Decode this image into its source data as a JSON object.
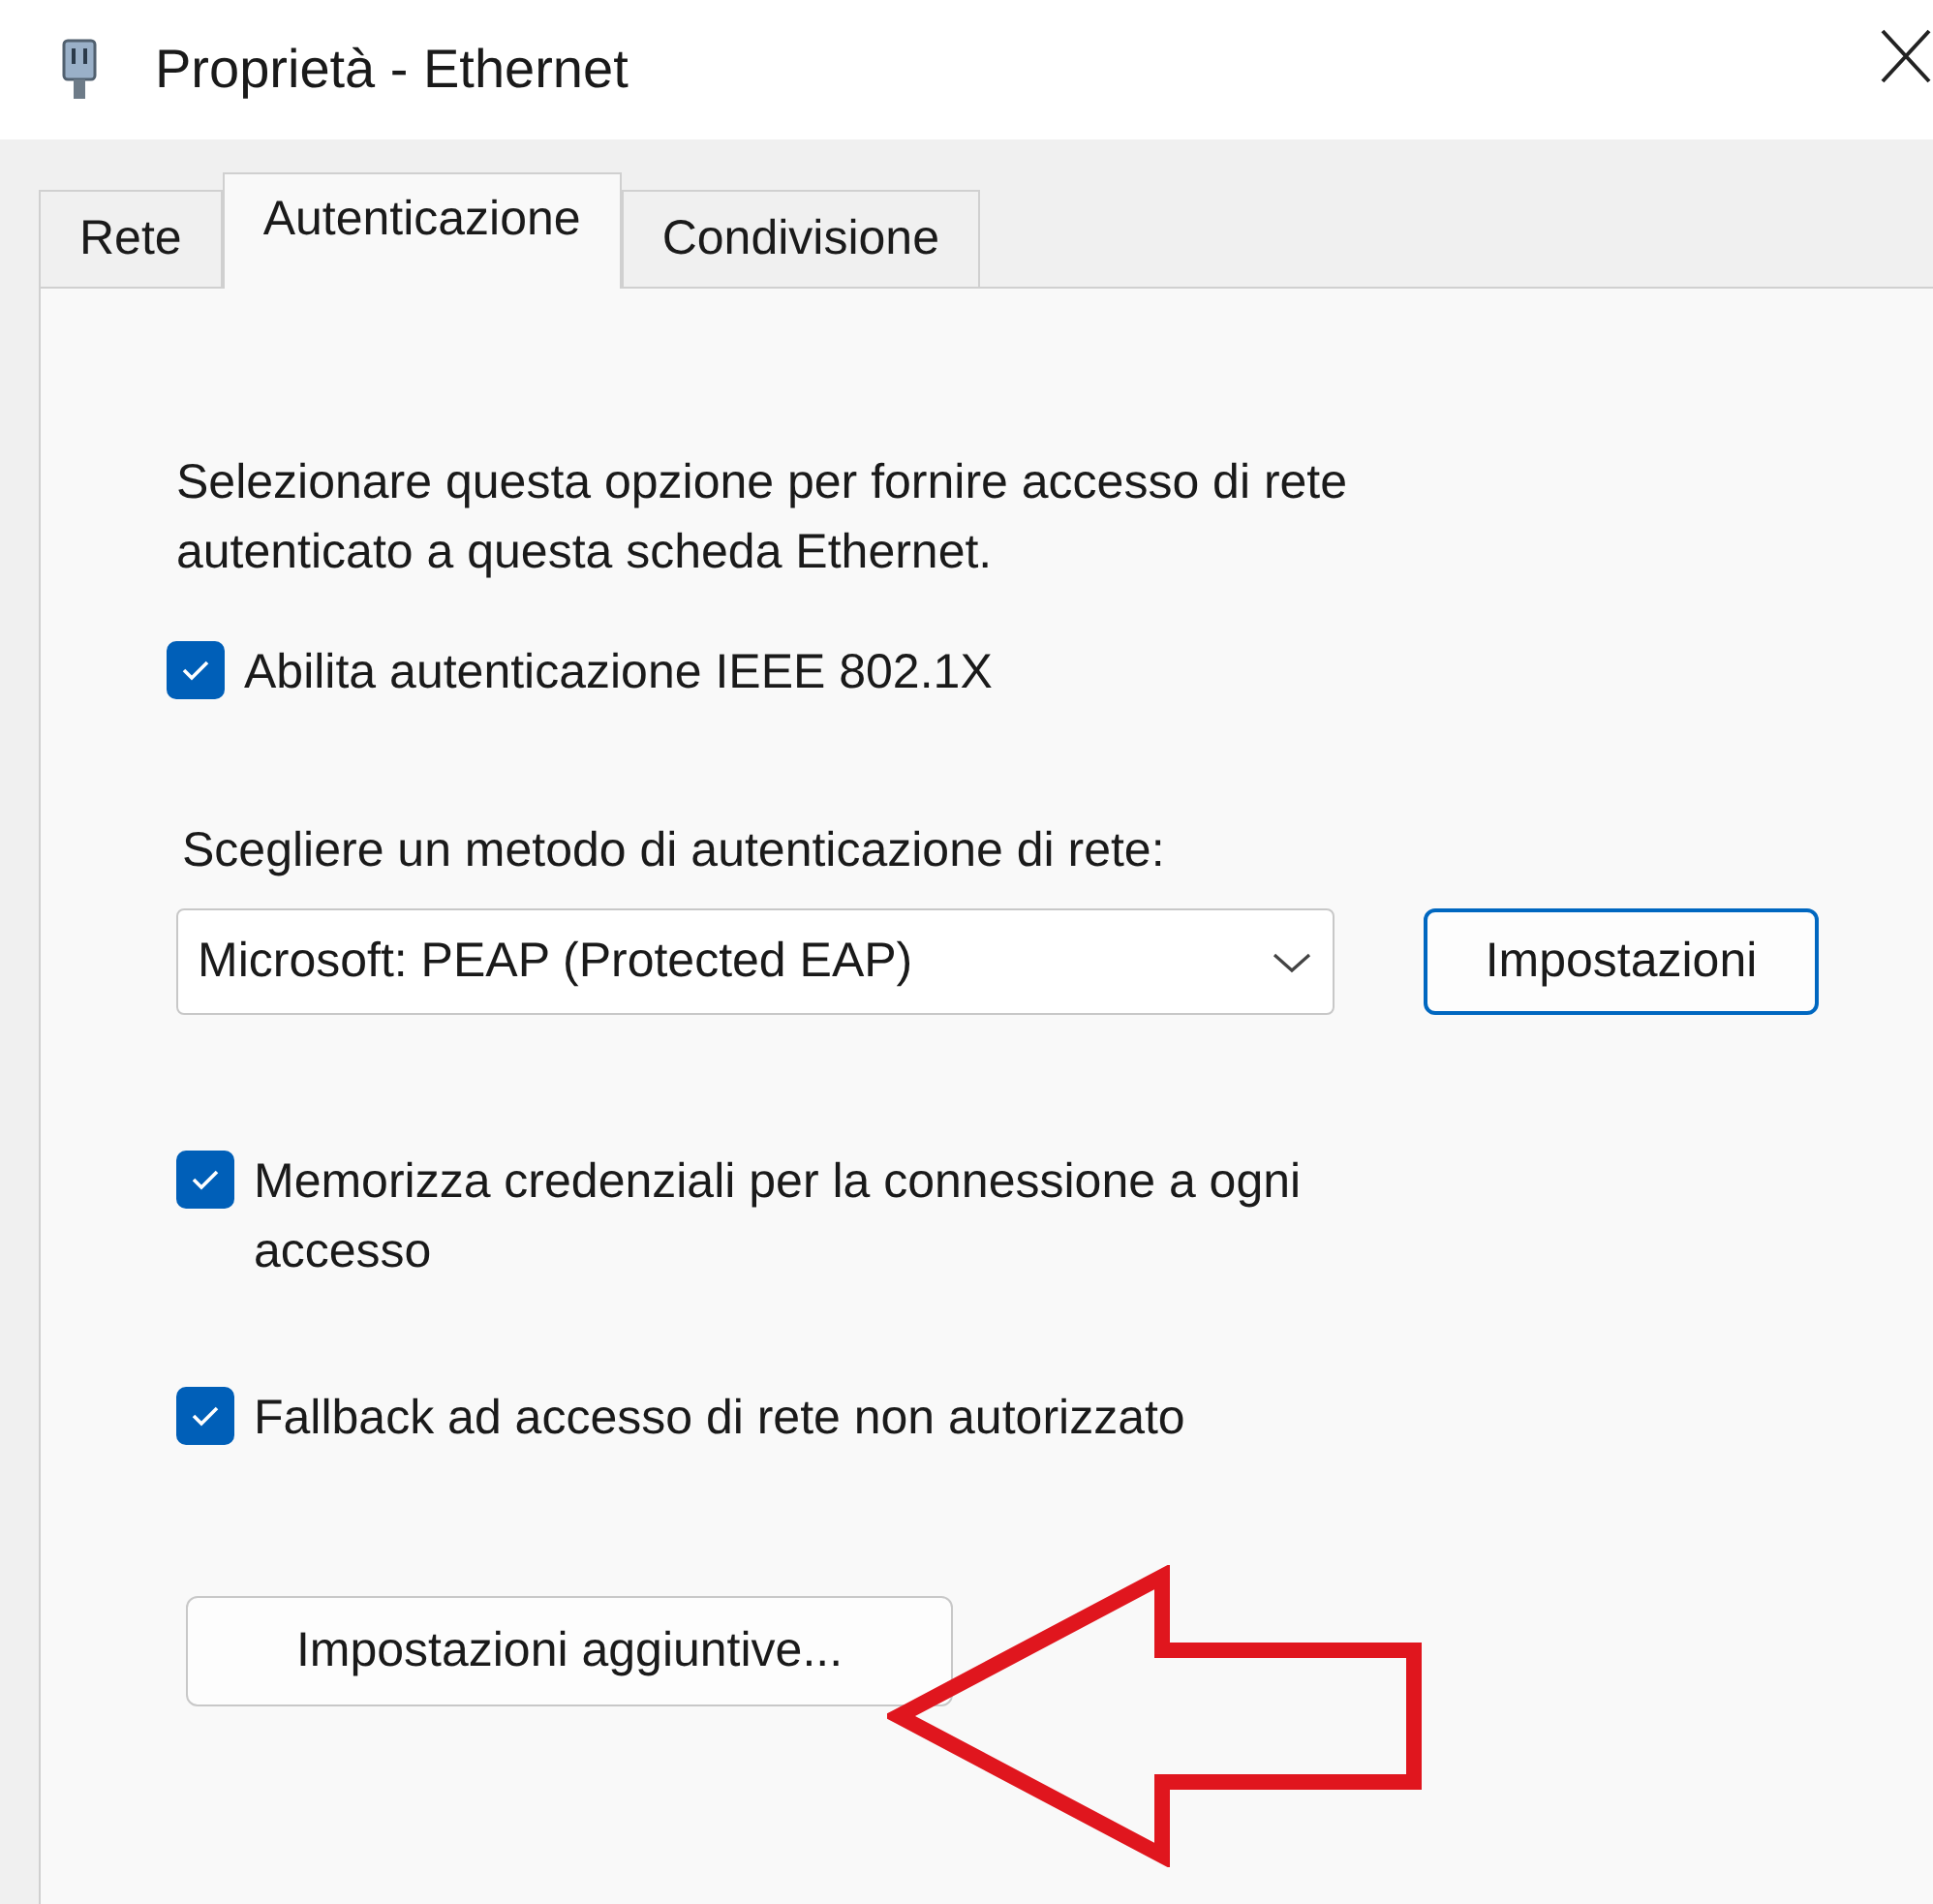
{
  "window": {
    "title": "Proprietà - Ethernet"
  },
  "tabs": [
    {
      "label": "Rete",
      "selected": false
    },
    {
      "label": "Autenticazione",
      "selected": true
    },
    {
      "label": "Condivisione",
      "selected": false
    }
  ],
  "description": "Selezionare questa opzione per fornire accesso di rete autenticato a questa scheda Ethernet.",
  "enable_option": {
    "label": "Abilita autenticazione IEEE 802.1X",
    "checked": true
  },
  "method": {
    "label": "Scegliere un metodo di autenticazione di rete:",
    "value": "Microsoft: PEAP (Protected EAP)",
    "settings_button": "Impostazioni"
  },
  "options": [
    {
      "label": "Memorizza credenziali per la connessione a ogni accesso",
      "checked": true
    },
    {
      "label": "Fallback ad accesso di rete non autorizzato",
      "checked": true
    }
  ],
  "additional_button": "Impostazioni aggiuntive..."
}
